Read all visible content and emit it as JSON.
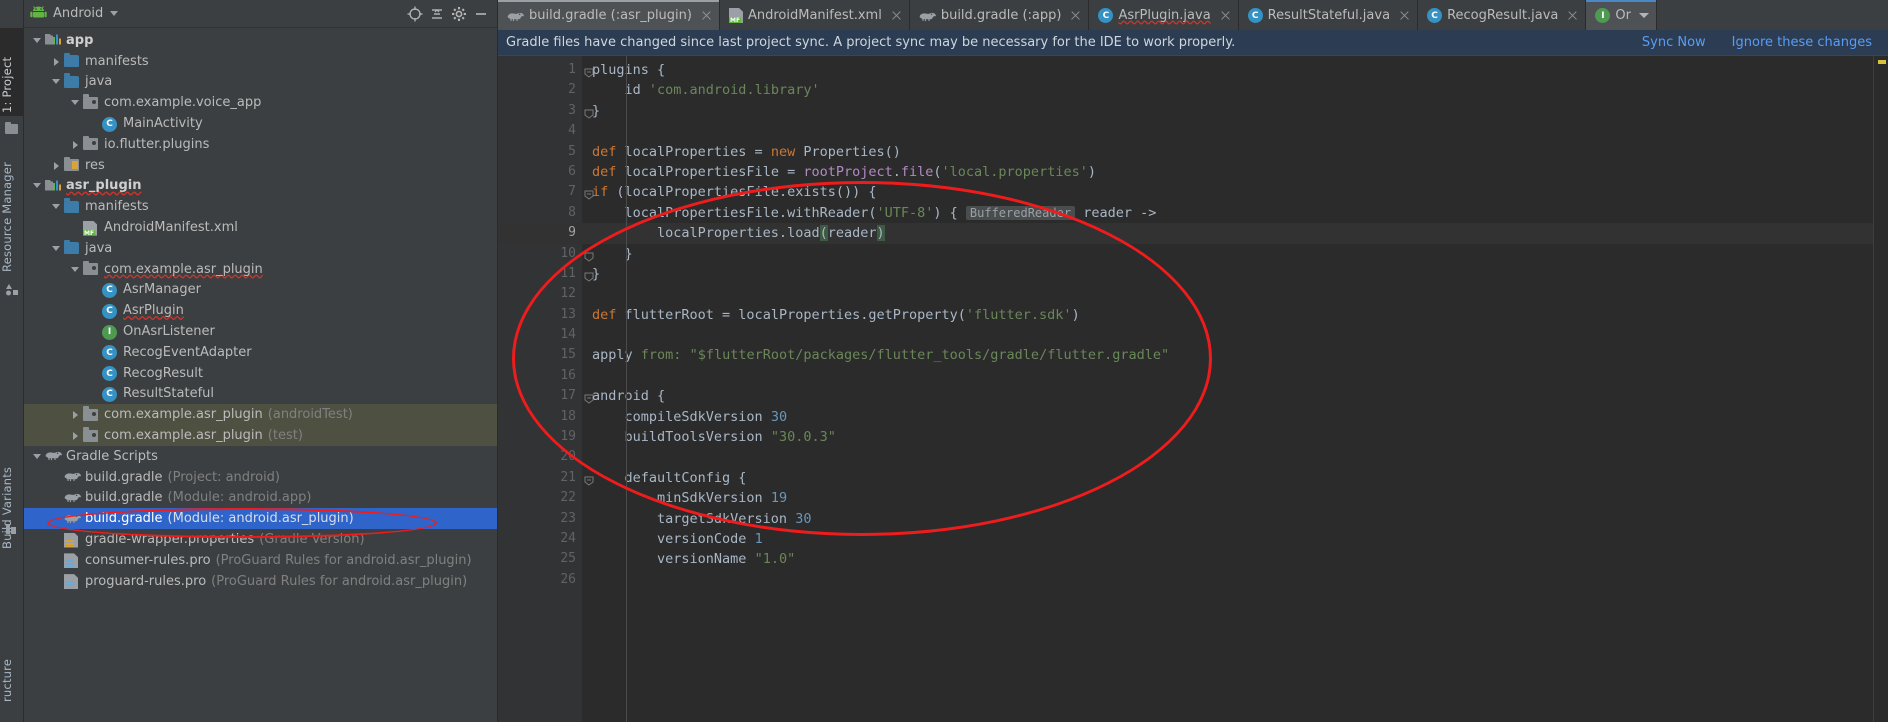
{
  "left_tool_strip": {
    "tabs": [
      {
        "label": "1: Project",
        "selected": true
      },
      {
        "label": "Resource Manager",
        "selected": false
      },
      {
        "label": "Build Variants",
        "selected": false
      },
      {
        "label": "ructure",
        "selected": false
      }
    ]
  },
  "project_panel": {
    "title": "Android",
    "header_icons": [
      "android-icon",
      "chevron-down-icon",
      "target-icon",
      "collapse-all-icon",
      "settings-gear-icon",
      "minimize-icon"
    ],
    "tree": [
      {
        "indent": 0,
        "arrow": "down",
        "icon": "module-icon",
        "label": "app",
        "bold": true,
        "sub": "",
        "state": "normal"
      },
      {
        "indent": 1,
        "arrow": "right",
        "icon": "folder-blue",
        "label": "manifests",
        "bold": false,
        "sub": "",
        "state": "normal"
      },
      {
        "indent": 1,
        "arrow": "down",
        "icon": "folder-blue",
        "label": "java",
        "bold": false,
        "sub": "",
        "state": "normal"
      },
      {
        "indent": 2,
        "arrow": "down",
        "icon": "package-icon",
        "label": "com.example.voice_app",
        "bold": false,
        "sub": "",
        "state": "normal"
      },
      {
        "indent": 3,
        "arrow": "none",
        "icon": "class-icon",
        "label": "MainActivity",
        "bold": false,
        "sub": "",
        "state": "normal"
      },
      {
        "indent": 2,
        "arrow": "right",
        "icon": "package-icon",
        "label": "io.flutter.plugins",
        "bold": false,
        "sub": "",
        "state": "normal"
      },
      {
        "indent": 1,
        "arrow": "right",
        "icon": "res-folder",
        "label": "res",
        "bold": false,
        "sub": "",
        "state": "normal"
      },
      {
        "indent": 0,
        "arrow": "down",
        "icon": "module-icon",
        "label": "asr_plugin",
        "bold": true,
        "sub": "",
        "state": "normal",
        "squiggle": true
      },
      {
        "indent": 1,
        "arrow": "down",
        "icon": "folder-blue",
        "label": "manifests",
        "bold": false,
        "sub": "",
        "state": "normal"
      },
      {
        "indent": 2,
        "arrow": "none",
        "icon": "manifest-icon",
        "label": "AndroidManifest.xml",
        "bold": false,
        "sub": "",
        "state": "normal"
      },
      {
        "indent": 1,
        "arrow": "down",
        "icon": "folder-blue",
        "label": "java",
        "bold": false,
        "sub": "",
        "state": "normal"
      },
      {
        "indent": 2,
        "arrow": "down",
        "icon": "package-icon",
        "label": "com.example.asr_plugin",
        "bold": false,
        "sub": "",
        "state": "normal",
        "squiggle": true
      },
      {
        "indent": 3,
        "arrow": "none",
        "icon": "class-icon",
        "label": "AsrManager",
        "bold": false,
        "sub": "",
        "state": "normal"
      },
      {
        "indent": 3,
        "arrow": "none",
        "icon": "class-icon",
        "label": "AsrPlugin",
        "bold": false,
        "sub": "",
        "state": "normal",
        "squiggle": true
      },
      {
        "indent": 3,
        "arrow": "none",
        "icon": "interface-icon",
        "label": "OnAsrListener",
        "bold": false,
        "sub": "",
        "state": "normal"
      },
      {
        "indent": 3,
        "arrow": "none",
        "icon": "class-icon",
        "label": "RecogEventAdapter",
        "bold": false,
        "sub": "",
        "state": "normal"
      },
      {
        "indent": 3,
        "arrow": "none",
        "icon": "class-icon",
        "label": "RecogResult",
        "bold": false,
        "sub": "",
        "state": "normal"
      },
      {
        "indent": 3,
        "arrow": "none",
        "icon": "class-icon",
        "label": "ResultStateful",
        "bold": false,
        "sub": "",
        "state": "normal"
      },
      {
        "indent": 2,
        "arrow": "right",
        "icon": "package-icon",
        "label": "com.example.asr_plugin",
        "bold": false,
        "sub": "(androidTest)",
        "state": "green"
      },
      {
        "indent": 2,
        "arrow": "right",
        "icon": "package-icon",
        "label": "com.example.asr_plugin",
        "bold": false,
        "sub": "(test)",
        "state": "green"
      },
      {
        "indent": 0,
        "arrow": "down",
        "icon": "gradle-icon",
        "label": "Gradle Scripts",
        "bold": false,
        "sub": "",
        "state": "normal"
      },
      {
        "indent": 1,
        "arrow": "none",
        "icon": "gradle-icon",
        "label": "build.gradle",
        "bold": false,
        "sub": "(Project: android)",
        "state": "normal"
      },
      {
        "indent": 1,
        "arrow": "none",
        "icon": "gradle-icon",
        "label": "build.gradle",
        "bold": false,
        "sub": "(Module: android.app)",
        "state": "normal"
      },
      {
        "indent": 1,
        "arrow": "none",
        "icon": "gradle-icon",
        "label": "build.gradle",
        "bold": false,
        "sub": "(Module: android.asr_plugin)",
        "state": "selected"
      },
      {
        "indent": 1,
        "arrow": "none",
        "icon": "properties-icon",
        "label": "gradle-wrapper.properties",
        "bold": false,
        "sub": "(Gradle Version)",
        "state": "normal"
      },
      {
        "indent": 1,
        "arrow": "none",
        "icon": "pro-icon",
        "label": "consumer-rules.pro",
        "bold": false,
        "sub": "(ProGuard Rules for android.asr_plugin)",
        "state": "normal"
      },
      {
        "indent": 1,
        "arrow": "none",
        "icon": "pro-icon",
        "label": "proguard-rules.pro",
        "bold": false,
        "sub": "(ProGuard Rules for android.asr_plugin)",
        "state": "normal"
      }
    ]
  },
  "editor_tabs": [
    {
      "label": "build.gradle (:asr_plugin)",
      "icon": "gradle-icon",
      "active": true,
      "closable": true
    },
    {
      "label": "AndroidManifest.xml",
      "icon": "manifest-icon",
      "active": false,
      "closable": true
    },
    {
      "label": "build.gradle (:app)",
      "icon": "gradle-icon",
      "active": false,
      "closable": true
    },
    {
      "label": "AsrPlugin.java",
      "icon": "class-icon",
      "active": false,
      "closable": true,
      "squiggle": true
    },
    {
      "label": "ResultStateful.java",
      "icon": "class-icon",
      "active": false,
      "closable": true
    },
    {
      "label": "RecogResult.java",
      "icon": "class-icon",
      "active": false,
      "closable": true
    },
    {
      "label": "Or",
      "icon": "interface-icon",
      "active": true,
      "closable": false,
      "chevron": true
    }
  ],
  "notification": {
    "message": "Gradle files have changed since last project sync. A project sync may be necessary for the IDE to work properly.",
    "sync_link": "Sync Now",
    "ignore_link": "Ignore these changes"
  },
  "code": {
    "current_line": 9,
    "inlay_hint": "BufferedReader",
    "lines": [
      {
        "n": 1,
        "fold": "open",
        "tokens": [
          {
            "t": "plugins {",
            "c": "plain"
          }
        ]
      },
      {
        "n": 2,
        "fold": "",
        "tokens": [
          {
            "t": "    id ",
            "c": "plain"
          },
          {
            "t": "'com.android.library'",
            "c": "str"
          }
        ]
      },
      {
        "n": 3,
        "fold": "close",
        "tokens": [
          {
            "t": "}",
            "c": "plain"
          }
        ]
      },
      {
        "n": 4,
        "fold": "",
        "tokens": []
      },
      {
        "n": 5,
        "fold": "",
        "tokens": [
          {
            "t": "def",
            "c": "kw"
          },
          {
            "t": " localProperties = ",
            "c": "plain"
          },
          {
            "t": "new",
            "c": "kw"
          },
          {
            "t": " Properties()",
            "c": "plain"
          }
        ]
      },
      {
        "n": 6,
        "fold": "",
        "tokens": [
          {
            "t": "def",
            "c": "kw"
          },
          {
            "t": " localPropertiesFile = ",
            "c": "plain"
          },
          {
            "t": "rootProject",
            "c": "fn"
          },
          {
            "t": ".",
            "c": "plain"
          },
          {
            "t": "file",
            "c": "fn"
          },
          {
            "t": "(",
            "c": "plain"
          },
          {
            "t": "'local.properties'",
            "c": "str"
          },
          {
            "t": ")",
            "c": "plain"
          }
        ]
      },
      {
        "n": 7,
        "fold": "open",
        "tokens": [
          {
            "t": "if",
            "c": "kw"
          },
          {
            "t": " (localPropertiesFile.exists()) {",
            "c": "plain"
          }
        ]
      },
      {
        "n": 8,
        "fold": "",
        "tokens": [
          {
            "t": "    localPropertiesFile.withReader(",
            "c": "plain"
          },
          {
            "t": "'UTF-8'",
            "c": "str"
          },
          {
            "t": ") { ",
            "c": "plain"
          },
          {
            "t": "BufferedReader",
            "c": "inlay"
          },
          {
            "t": " reader ->",
            "c": "plain"
          }
        ]
      },
      {
        "n": 9,
        "fold": "open",
        "tokens": [
          {
            "t": "        localProperties.load",
            "c": "plain"
          },
          {
            "t": "(",
            "c": "hl"
          },
          {
            "t": "reader",
            "c": "plain"
          },
          {
            "t": ")",
            "c": "hl"
          }
        ]
      },
      {
        "n": 10,
        "fold": "close",
        "tokens": [
          {
            "t": "    }",
            "c": "plain"
          }
        ]
      },
      {
        "n": 11,
        "fold": "close",
        "tokens": [
          {
            "t": "}",
            "c": "plain"
          }
        ]
      },
      {
        "n": 12,
        "fold": "",
        "tokens": []
      },
      {
        "n": 13,
        "fold": "",
        "tokens": [
          {
            "t": "def",
            "c": "kw"
          },
          {
            "t": " flutterRoot = localProperties.getProperty(",
            "c": "plain"
          },
          {
            "t": "'flutter.sdk'",
            "c": "str"
          },
          {
            "t": ")",
            "c": "plain"
          }
        ]
      },
      {
        "n": 14,
        "fold": "",
        "tokens": []
      },
      {
        "n": 15,
        "fold": "",
        "tokens": [
          {
            "t": "apply ",
            "c": "plain"
          },
          {
            "t": "from:",
            "c": "str"
          },
          {
            "t": " ",
            "c": "plain"
          },
          {
            "t": "\"$flutterRoot",
            "c": "str"
          },
          {
            "t": "/packages/flutter_tools/gradle/flutter.gradle\"",
            "c": "str"
          }
        ]
      },
      {
        "n": 16,
        "fold": "",
        "tokens": []
      },
      {
        "n": 17,
        "fold": "open",
        "tokens": [
          {
            "t": "android {",
            "c": "plain"
          }
        ]
      },
      {
        "n": 18,
        "fold": "",
        "tokens": [
          {
            "t": "    compileSdkVersion ",
            "c": "plain"
          },
          {
            "t": "30",
            "c": "num"
          }
        ]
      },
      {
        "n": 19,
        "fold": "",
        "tokens": [
          {
            "t": "    buildToolsVersion ",
            "c": "plain"
          },
          {
            "t": "\"30.0.3\"",
            "c": "str"
          }
        ]
      },
      {
        "n": 20,
        "fold": "",
        "tokens": []
      },
      {
        "n": 21,
        "fold": "open",
        "tokens": [
          {
            "t": "    defaultConfig {",
            "c": "plain"
          }
        ]
      },
      {
        "n": 22,
        "fold": "",
        "tokens": [
          {
            "t": "        minSdkVersion ",
            "c": "plain"
          },
          {
            "t": "19",
            "c": "num"
          }
        ]
      },
      {
        "n": 23,
        "fold": "",
        "tokens": [
          {
            "t": "        targetSdkVersion ",
            "c": "plain"
          },
          {
            "t": "30",
            "c": "num"
          }
        ]
      },
      {
        "n": 24,
        "fold": "",
        "tokens": [
          {
            "t": "        versionCode ",
            "c": "plain"
          },
          {
            "t": "1",
            "c": "num"
          }
        ]
      },
      {
        "n": 25,
        "fold": "",
        "tokens": [
          {
            "t": "        versionName ",
            "c": "plain"
          },
          {
            "t": "\"1.0\"",
            "c": "str"
          }
        ]
      },
      {
        "n": 26,
        "fold": "",
        "tokens": []
      }
    ]
  },
  "colors": {
    "panel_bg": "#3c3f41",
    "editor_bg": "#2b2b2b",
    "selection_blue": "#2f65ca",
    "test_green": "#4e5142",
    "annotation_red": "#ee1c1c",
    "link_blue": "#589df6",
    "notification_bg": "#2c3c52"
  }
}
